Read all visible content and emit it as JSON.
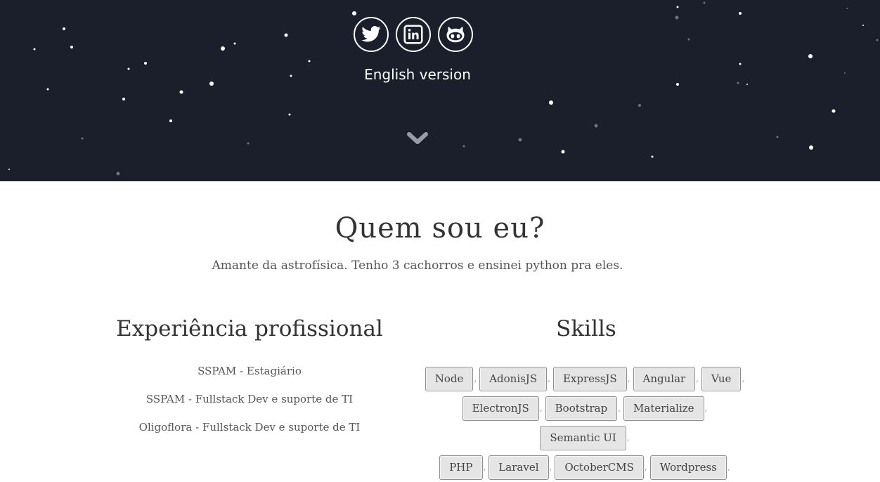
{
  "header": {
    "social": [
      {
        "name": "twitter-icon",
        "label": "Twitter"
      },
      {
        "name": "linkedin-icon",
        "label": "LinkedIn"
      },
      {
        "name": "github-icon",
        "label": "GitHub"
      }
    ],
    "language_link": "English version"
  },
  "about": {
    "title": "Quem sou eu?",
    "bio": "Amante da astrofísica. Tenho 3 cachorros e ensinei python pra eles."
  },
  "experience": {
    "title": "Experiência profissional",
    "items": [
      "SSPAM - Estagiário",
      "SSPAM - Fullstack Dev e suporte de TI",
      "Oligoflora - Fullstack Dev e suporte de TI"
    ]
  },
  "skills": {
    "title": "Skills",
    "items": [
      "Node",
      "AdonisJS",
      "ExpressJS",
      "Angular",
      "Vue",
      "ElectronJS",
      "Bootstrap",
      "Materialize",
      "Semantic UI",
      "PHP",
      "Laravel",
      "OctoberCMS",
      "Wordpress"
    ],
    "separator": ","
  },
  "colors": {
    "hero_bg": "#1b1f2b",
    "tag_bg": "#e5e5e5",
    "tag_border": "#8d8d8d"
  }
}
